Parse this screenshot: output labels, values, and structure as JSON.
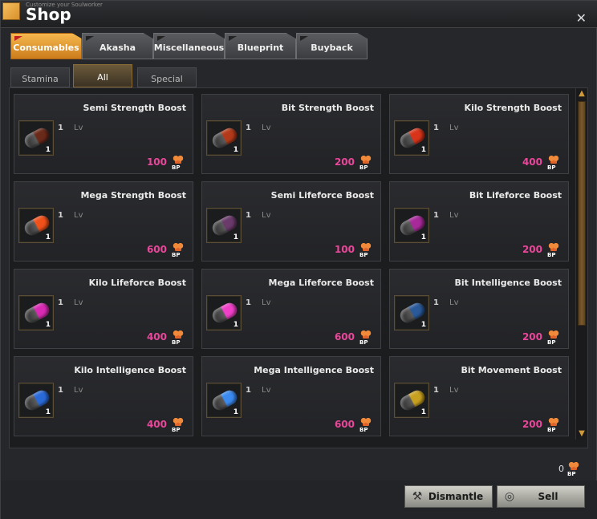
{
  "window": {
    "subtitle": "Customize your Soulworker",
    "title": "Shop"
  },
  "tabs": [
    {
      "label": "Consumables",
      "active": true
    },
    {
      "label": "Akasha",
      "active": false
    },
    {
      "label": "Miscellaneous",
      "active": false
    },
    {
      "label": "Blueprint",
      "active": false
    },
    {
      "label": "Buyback",
      "active": false
    }
  ],
  "subtabs": [
    {
      "label": "Stamina",
      "active": false
    },
    {
      "label": "All",
      "active": true
    },
    {
      "label": "Special",
      "active": false
    }
  ],
  "currency_label": "BP",
  "lv_label": "Lv",
  "items": [
    {
      "name": "Semi Strength Boost",
      "level": "1",
      "qty": "1",
      "price": "100",
      "color": "#6a2a1a"
    },
    {
      "name": "Bit Strength Boost",
      "level": "1",
      "qty": "1",
      "price": "200",
      "color": "#b23a1a"
    },
    {
      "name": "Kilo Strength Boost",
      "level": "1",
      "qty": "1",
      "price": "400",
      "color": "#d8341a"
    },
    {
      "name": "Mega Strength Boost",
      "level": "1",
      "qty": "1",
      "price": "600",
      "color": "#f0501a"
    },
    {
      "name": "Semi Lifeforce Boost",
      "level": "1",
      "qty": "1",
      "price": "100",
      "color": "#6a3a6a"
    },
    {
      "name": "Bit Lifeforce Boost",
      "level": "1",
      "qty": "1",
      "price": "200",
      "color": "#a82a9a"
    },
    {
      "name": "Kilo Lifeforce Boost",
      "level": "1",
      "qty": "1",
      "price": "400",
      "color": "#d82ab2"
    },
    {
      "name": "Mega Lifeforce Boost",
      "level": "1",
      "qty": "1",
      "price": "600",
      "color": "#f040c8"
    },
    {
      "name": "Bit Intelligence Boost",
      "level": "1",
      "qty": "1",
      "price": "200",
      "color": "#2a5a9a"
    },
    {
      "name": "Kilo Intelligence Boost",
      "level": "1",
      "qty": "1",
      "price": "400",
      "color": "#2a6ad8"
    },
    {
      "name": "Mega Intelligence Boost",
      "level": "1",
      "qty": "1",
      "price": "600",
      "color": "#3a8af0"
    },
    {
      "name": "Bit Movement Boost",
      "level": "1",
      "qty": "1",
      "price": "200",
      "color": "#c8a020"
    }
  ],
  "balance": "0",
  "buttons": {
    "dismantle": "Dismantle",
    "sell": "Sell"
  }
}
